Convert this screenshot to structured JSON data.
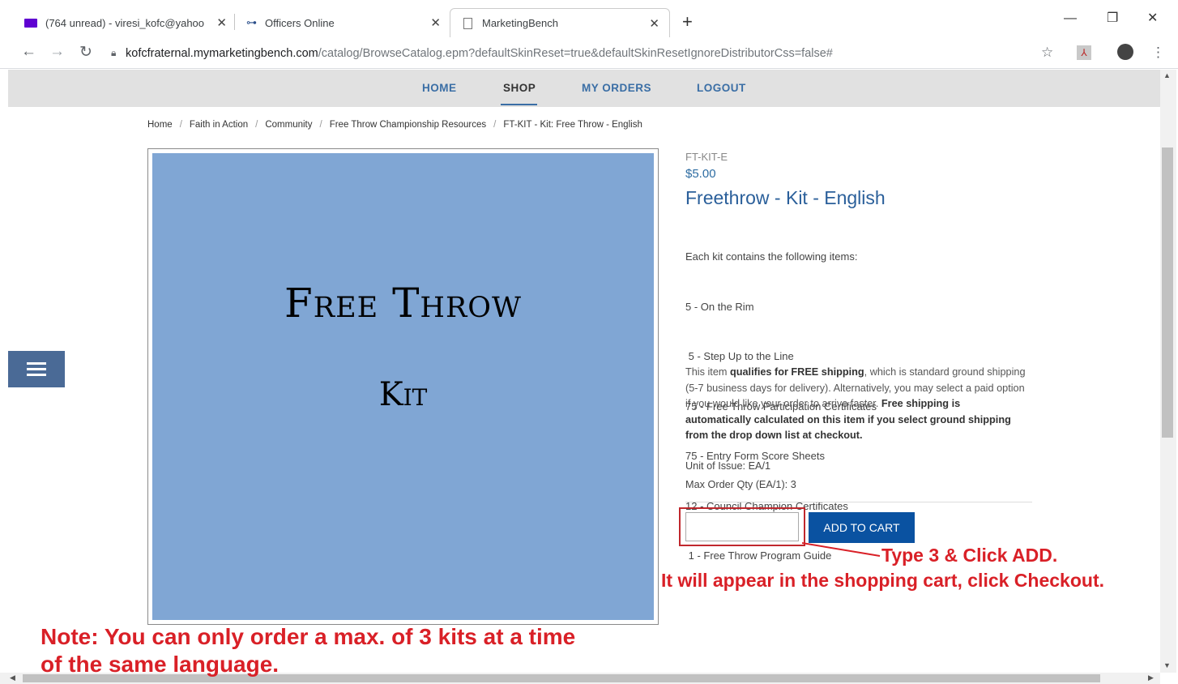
{
  "browser": {
    "tabs": [
      {
        "title": "(764 unread) - viresi_kofc@yahoo",
        "icon": "mail-icon"
      },
      {
        "title": "Officers Online",
        "icon": "key-icon"
      },
      {
        "title": "MarketingBench",
        "icon": "page-icon"
      }
    ],
    "url_host": "kofcfraternal.mymarketingbench.com",
    "url_path": "/catalog/BrowseCatalog.epm?defaultSkinReset=true&defaultSkinResetIgnoreDistributorCss=false#"
  },
  "nav": {
    "items": [
      "HOME",
      "SHOP",
      "MY ORDERS",
      "LOGOUT"
    ],
    "active": "SHOP"
  },
  "breadcrumb": [
    "Home",
    "Faith in Action",
    "Community",
    "Free Throw Championship Resources",
    "FT-KIT - Kit: Free Throw - English"
  ],
  "product": {
    "image_title": "Free Throw",
    "image_subtitle": "Kit",
    "image_bg": "#80a6d4",
    "sku": "FT-KIT-E",
    "price": "$5.00",
    "name": "Freethrow - Kit - English",
    "description_lines": [
      "Each kit contains the following items:",
      "5 - On the Rim",
      " 5 - Step Up to the Line",
      "75 - Free Throw Participation Certificates",
      "75 - Entry Form Score Sheets",
      "12 - Council Champion Certificates",
      " 1 - Free Throw Program Guide"
    ],
    "shipping_pre": "This item ",
    "shipping_bold1": "qualifies for FREE shipping",
    "shipping_mid": ", which is standard ground shipping (5-7 business days for delivery). Alternatively, you may select a paid option if you would like your order to arrive faster. ",
    "shipping_bold2": "Free shipping is automatically calculated on this item if you select ground shipping from the drop down list at checkout.",
    "unit_of_issue": "Unit of Issue: EA/1",
    "max_order": "Max Order Qty (EA/1): 3",
    "quantity_value": "",
    "add_to_cart": "ADD TO CART"
  },
  "annotations": {
    "step": "Type 3 & Click ADD.",
    "cart": "It will appear in the shopping cart, click Checkout.",
    "note_line1": "Note: You can only order a max. of 3 kits at a time",
    "note_line2": "of the same language.",
    "color": "#d92027"
  },
  "colors": {
    "nav_link": "#3a6ea5",
    "product_title": "#2a5f9a",
    "button": "#0a52a1"
  }
}
